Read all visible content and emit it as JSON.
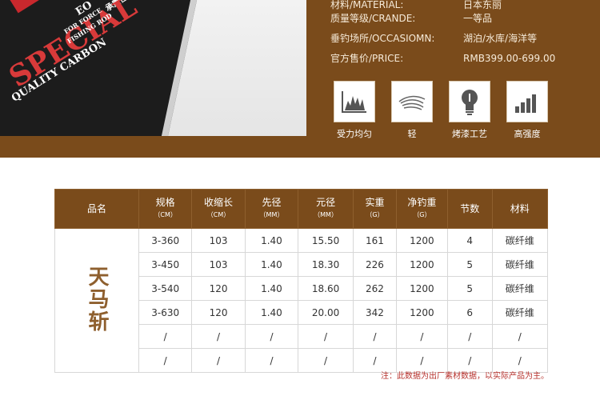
{
  "product_image": {
    "brand_box": "EO",
    "line1": "承重性",
    "line2": "SPECIAL",
    "line3": "QUALITY CARBON",
    "small1": "FOR FORCE",
    "small2": "FISHING ROD"
  },
  "specs": [
    {
      "label": "材料/MATERIAL:",
      "value": "日本东丽"
    },
    {
      "label": "质量等级/CRANDE:",
      "value": "一等品"
    },
    {
      "label": "垂钓场所/OCCASIOMN:",
      "value": "湖泊/水库/海洋等"
    },
    {
      "label": "官方售价/PRICE:",
      "value": "RMB399.00-699.00"
    }
  ],
  "features": [
    {
      "icon": "balance-chart-icon",
      "label": "受力均匀"
    },
    {
      "icon": "feather-icon",
      "label": "轻"
    },
    {
      "icon": "light-bulb-icon",
      "label": "烤漆工艺"
    },
    {
      "icon": "strength-bars-icon",
      "label": "高强度"
    }
  ],
  "table": {
    "headers": [
      {
        "main": "品名",
        "unit": ""
      },
      {
        "main": "规格",
        "unit": "（CM）"
      },
      {
        "main": "收缩长",
        "unit": "（CM）"
      },
      {
        "main": "先径",
        "unit": "（MM）"
      },
      {
        "main": "元径",
        "unit": "（MM）"
      },
      {
        "main": "实重",
        "unit": "（G）"
      },
      {
        "main": "净钓重",
        "unit": "（G）"
      },
      {
        "main": "节数",
        "unit": ""
      },
      {
        "main": "材料",
        "unit": ""
      }
    ],
    "product_name": "天马斩",
    "rows": [
      [
        "3-360",
        "103",
        "1.40",
        "15.50",
        "161",
        "1200",
        "4",
        "碳纤维"
      ],
      [
        "3-450",
        "103",
        "1.40",
        "18.30",
        "226",
        "1200",
        "5",
        "碳纤维"
      ],
      [
        "3-540",
        "120",
        "1.40",
        "18.60",
        "262",
        "1200",
        "5",
        "碳纤维"
      ],
      [
        "3-630",
        "120",
        "1.40",
        "20.00",
        "342",
        "1200",
        "6",
        "碳纤维"
      ],
      [
        "/",
        "/",
        "/",
        "/",
        "/",
        "/",
        "/",
        "/"
      ],
      [
        "/",
        "/",
        "/",
        "/",
        "/",
        "/",
        "/",
        "/"
      ]
    ]
  },
  "note": "注：此数据为出厂素材数据，以实际产品为主。",
  "colors": {
    "brown": "#7a4b1b",
    "note_red": "#b7312c",
    "brand_text": "#8e5f2e"
  }
}
